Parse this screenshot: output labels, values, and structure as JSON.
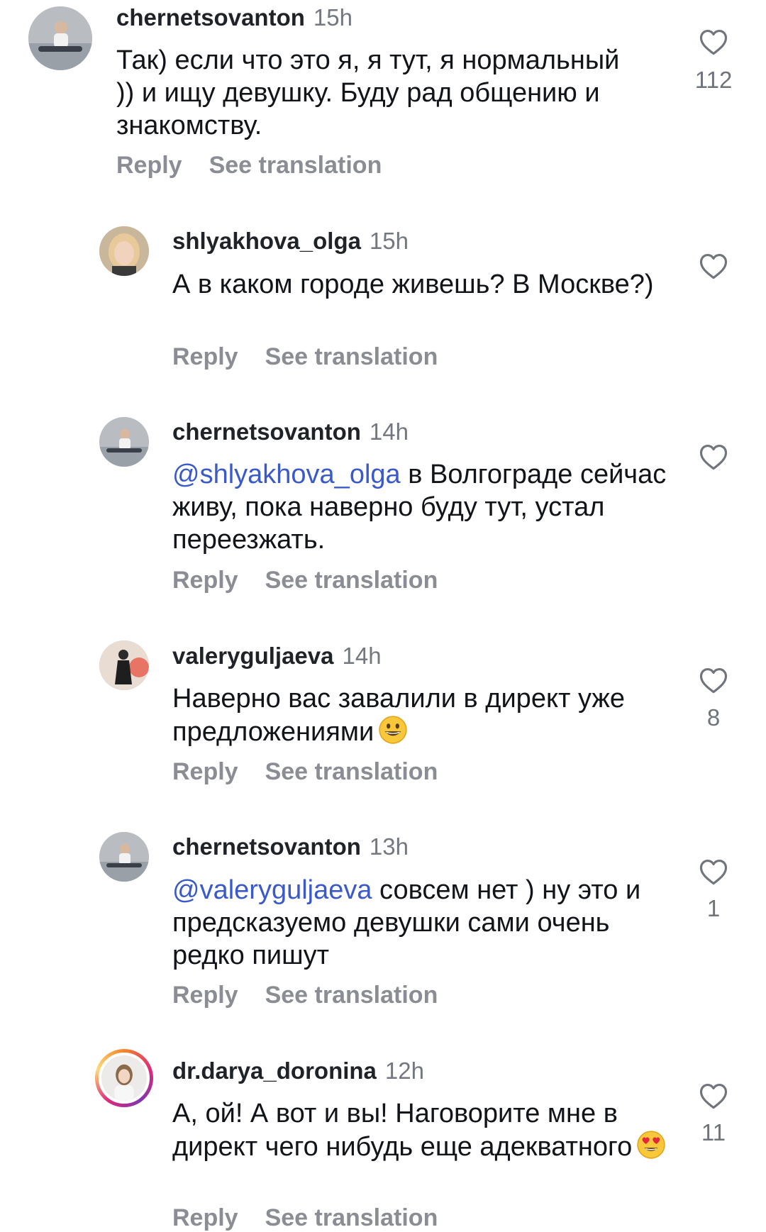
{
  "actions": {
    "reply": "Reply",
    "translate": "See translation"
  },
  "comments": [
    {
      "username": "chernetsovanton",
      "time": "15h",
      "mention": "",
      "text": "Так) если что это я, я тут, я нормальный )) и ищу девушку. Буду рад общению и знакомству.",
      "likes": "112",
      "emoji": ""
    },
    {
      "username": "shlyakhova_olga",
      "time": "15h",
      "mention": "",
      "text": "А в каком городе живешь? В Москве?)",
      "likes": "",
      "emoji": ""
    },
    {
      "username": "chernetsovanton",
      "time": "14h",
      "mention": "@shlyakhova_olga",
      "text": " в Волгограде сейчас живу, пока наверно буду тут, устал переезжать.",
      "likes": "",
      "emoji": ""
    },
    {
      "username": "valeryguljaeva",
      "time": "14h",
      "mention": "",
      "text": "Наверно вас завалили в директ уже предложениями",
      "likes": "8",
      "emoji": "grinning-face-emoji"
    },
    {
      "username": "chernetsovanton",
      "time": "13h",
      "mention": "@valeryguljaeva",
      "text": " совсем нет ) ну это и предсказуемо девушки сами очень редко пишут",
      "likes": "1",
      "emoji": ""
    },
    {
      "username": "dr.darya_doronina",
      "time": "12h",
      "mention": "",
      "text": "А, ой! А вот и вы! Наговорите мне в директ чего нибудь еще адекватного",
      "likes": "11",
      "emoji": "heart-eyes-emoji"
    }
  ]
}
